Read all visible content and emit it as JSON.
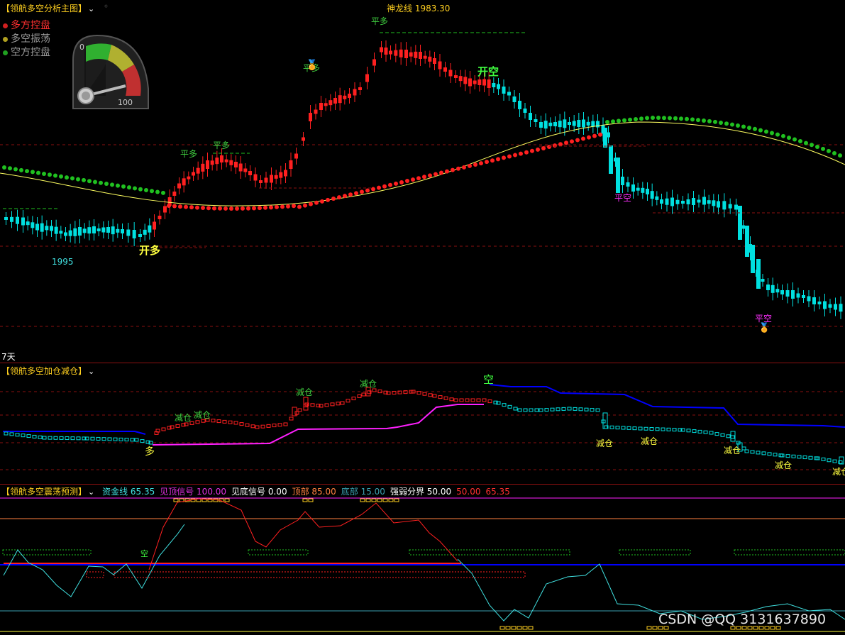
{
  "main": {
    "title": "【领航多空分析主图】",
    "shenlong_label": "神龙线 1983.30",
    "legend": [
      {
        "label": "多方控盘",
        "color": "#ff3030",
        "dot": "#d02020"
      },
      {
        "label": "多空振荡",
        "color": "#9a9a9a",
        "dot": "#b0a020"
      },
      {
        "label": "空方控盘",
        "color": "#9a9a9a",
        "dot": "#20a020"
      }
    ],
    "gauge_min": "0",
    "gauge_max": "100",
    "low_price": "1995",
    "period": "7天",
    "signals": {
      "kaiduo": "开多",
      "kaikong": "开空",
      "pingduo1": "平多",
      "pingduo2": "平多",
      "pingduo3": "平多",
      "pingduo4": "平多",
      "pingkong1": "平空",
      "pingkong2": "平空"
    }
  },
  "sub1": {
    "title": "【领航多空加仓减仓】",
    "duo": "多",
    "kong": "空",
    "jiancang": "减仓"
  },
  "sub2": {
    "title": "【领航多空震荡预测】",
    "items": [
      {
        "label": "资金线",
        "value": "65.35",
        "color": "#40e0e0"
      },
      {
        "label": "见顶信号",
        "value": "100.00",
        "color": "#e030e0"
      },
      {
        "label": "见底信号",
        "value": "0.00",
        "color": "#ffffff"
      },
      {
        "label": "顶部",
        "value": "85.00",
        "color": "#ff8040"
      },
      {
        "label": "底部",
        "value": "15.00",
        "color": "#3aa0b0"
      },
      {
        "label": "强弱分界",
        "value": "50.00",
        "color": "#ffffff"
      },
      {
        "label": "",
        "value": "50.00",
        "color": "#ff3030"
      },
      {
        "label": "",
        "value": "65.35",
        "color": "#ff3030"
      }
    ],
    "kong_mark": "空"
  },
  "watermark": "CSDN @QQ 3131637890",
  "colors": {
    "up": "#ff2020",
    "down": "#00e0e0",
    "grid": "#8a1010",
    "yellow": "#ffff40",
    "green": "#20c020",
    "magenta": "#ff20ff",
    "blue": "#0000ff"
  }
}
